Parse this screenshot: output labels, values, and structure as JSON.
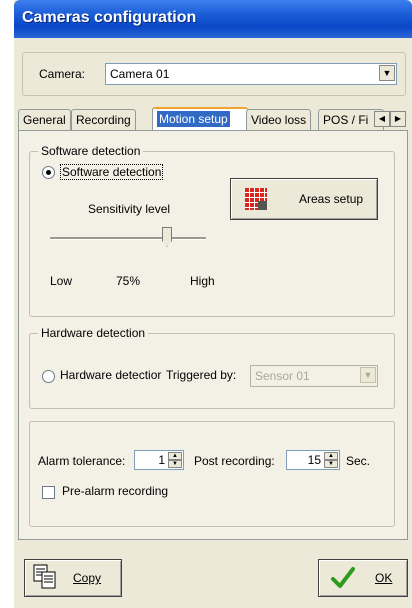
{
  "window": {
    "title": "Cameras configuration"
  },
  "camera": {
    "label": "Camera:",
    "selected": "Camera 01"
  },
  "tabs": [
    {
      "label": "General"
    },
    {
      "label": "Recording"
    },
    {
      "label": "Motion setup"
    },
    {
      "label": "Video loss"
    },
    {
      "label": "POS / Fi"
    }
  ],
  "software": {
    "group_label": "Software detection",
    "radio_label": "Software detection",
    "radio_checked": true,
    "areas_button": "Areas setup",
    "sensitivity_label": "Sensitivity level",
    "sensitivity_value": 0.75,
    "low_label": "Low",
    "value_label": "75%",
    "high_label": "High"
  },
  "hardware": {
    "group_label": "Hardware detection",
    "radio_label": "Hardware detectior",
    "triggered_label": "Triggered by:",
    "sensor_value": "Sensor 01"
  },
  "alarm": {
    "tolerance_label": "Alarm tolerance:",
    "tolerance_value": "1",
    "post_label": "Post recording:",
    "post_value": "15",
    "sec_label": "Sec.",
    "prealarm_label": "Pre-alarm recording"
  },
  "buttons": {
    "copy": "Copy",
    "ok": "OK"
  },
  "colors": {
    "title_bar": "#0a47c6",
    "tab_highlight": "#316ac5",
    "ok_check": "#2e9a1e"
  }
}
